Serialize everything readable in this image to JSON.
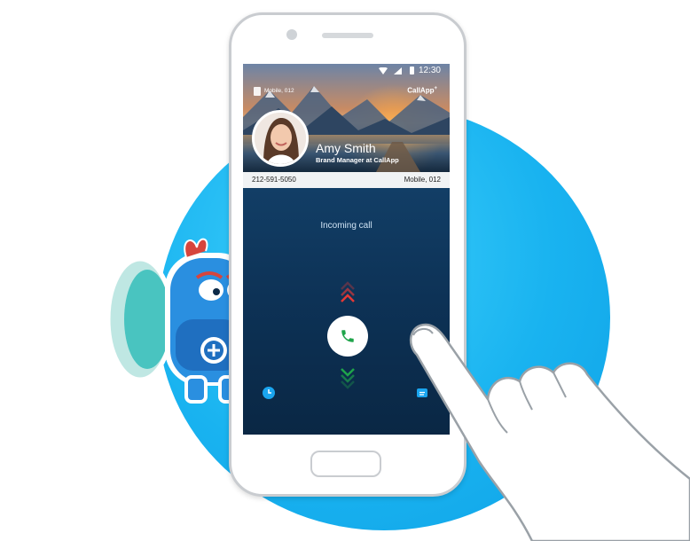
{
  "status_bar": {
    "time": "12:30"
  },
  "header": {
    "sim_label": "Mobile, 012",
    "brand": "CallApp"
  },
  "contact": {
    "name": "Amy Smith",
    "title": "Brand Manager at CallApp",
    "phone_number": "212-591-5050",
    "number_type": "Mobile, 012"
  },
  "call": {
    "state_label": "Incoming call"
  },
  "icons": {
    "answer": "phone-icon",
    "decline_indicator": "chevron-up-icon",
    "accept_indicator": "chevron-down-icon",
    "recent": "clock-icon",
    "message": "chat-bubble-icon"
  },
  "colors": {
    "accent_blue": "#19b3f0",
    "answer_green": "#1fa44a",
    "decline_red": "#e53935",
    "screen_blue": "#0d3256"
  }
}
